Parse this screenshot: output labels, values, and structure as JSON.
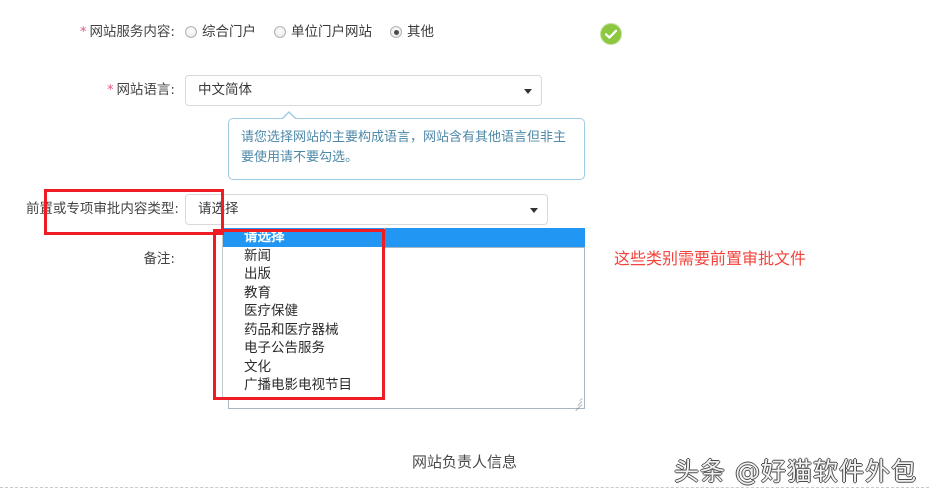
{
  "form": {
    "service_content": {
      "required_mark": "*",
      "label": "网站服务内容:",
      "options": [
        {
          "label": "综合门户",
          "checked": false
        },
        {
          "label": "单位门户网站",
          "checked": false
        },
        {
          "label": "其他",
          "checked": true
        }
      ],
      "status_icon": "check-circle-icon",
      "status_color": "#8dc63f"
    },
    "site_language": {
      "required_mark": "*",
      "label": "网站语言:",
      "value": "中文简体",
      "hint": "请您选择网站的主要构成语言，网站含有其他语言但非主要使用请不要勾选。",
      "hint_border_color": "#9ecbe2",
      "hint_text_color": "#4d88a8"
    },
    "approval_type": {
      "label": "前置或专项审批内容类型:",
      "value": "请选择",
      "expanded": true,
      "highlight_color": "#2196f3",
      "options": [
        "请选择",
        "新闻",
        "出版",
        "教育",
        "医疗保健",
        "药品和医疗器械",
        "电子公告服务",
        "文化",
        "广播电影电视节目"
      ],
      "selected_index": 0
    },
    "remark": {
      "label": "备注:",
      "value": ""
    }
  },
  "annotations": {
    "color": "#ee1c25",
    "note_text": "这些类别需要前置审批文件",
    "note_color": "#f4433c"
  },
  "footer": {
    "section_title": "网站负责人信息",
    "watermark": "头条 @好猫软件外包"
  }
}
